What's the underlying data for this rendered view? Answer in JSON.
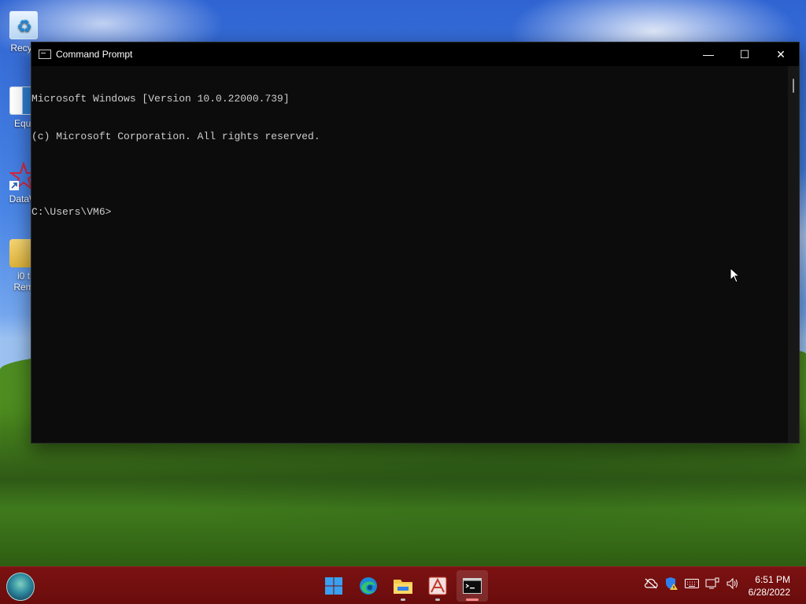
{
  "desktop": {
    "icons": [
      {
        "label": "Recyc"
      },
      {
        "label": "Equi"
      },
      {
        "label": "DataW"
      },
      {
        "label": "i0 t",
        "label2": "Rem"
      }
    ]
  },
  "window": {
    "title": "Command Prompt",
    "controls": {
      "minimize": "—",
      "maximize": "☐",
      "close": "✕"
    },
    "console_lines": [
      "Microsoft Windows [Version 10.0.22000.739]",
      "(c) Microsoft Corporation. All rights reserved.",
      "",
      "C:\\Users\\VM6>"
    ]
  },
  "taskbar": {
    "apps": [
      "start-button",
      "edge",
      "file-explorer",
      "datawatch",
      "command-prompt"
    ],
    "clock": {
      "time": "6:51 PM",
      "date": "6/28/2022"
    }
  },
  "colors": {
    "console_bg": "#0c0c0c",
    "console_text": "#cccccc",
    "taskbar": "#7c1212"
  }
}
